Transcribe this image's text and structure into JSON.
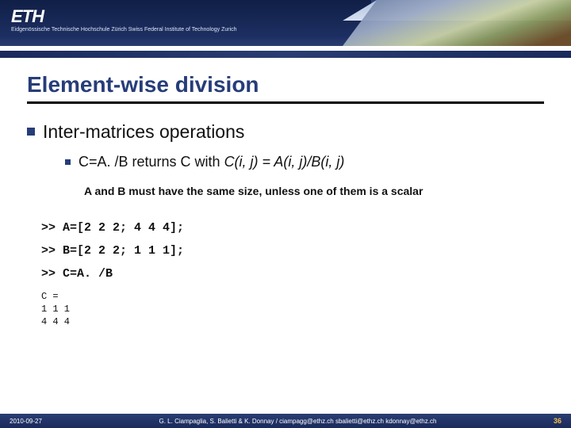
{
  "banner": {
    "logo": "ETH",
    "subtitle": "Eidgenössische Technische Hochschule Zürich   Swiss Federal Institute of Technology Zurich"
  },
  "title": "Element-wise division",
  "bullets": {
    "l1": "Inter-matrices operations",
    "l2_pre": "C=A. /B returns C with ",
    "l2_ital": "C(i, j) = A(i, j)/B(i, j)"
  },
  "note": "A and B must have the same size, unless one of them is a scalar",
  "code": {
    "line1": ">> A=[2 2 2; 4 4 4];",
    "line2": ">> B=[2 2 2; 1 1 1];",
    "line3": ">> C=A. /B",
    "output": "C =\n1 1 1\n4 4 4"
  },
  "footer": {
    "date": "2010-09-27",
    "authors": "G. L. Ciampaglia, S. Balietti & K. Donnay / ciampagg@ethz.ch  sbalietti@ethz.ch  kdonnay@ethz.ch",
    "page": "36"
  }
}
